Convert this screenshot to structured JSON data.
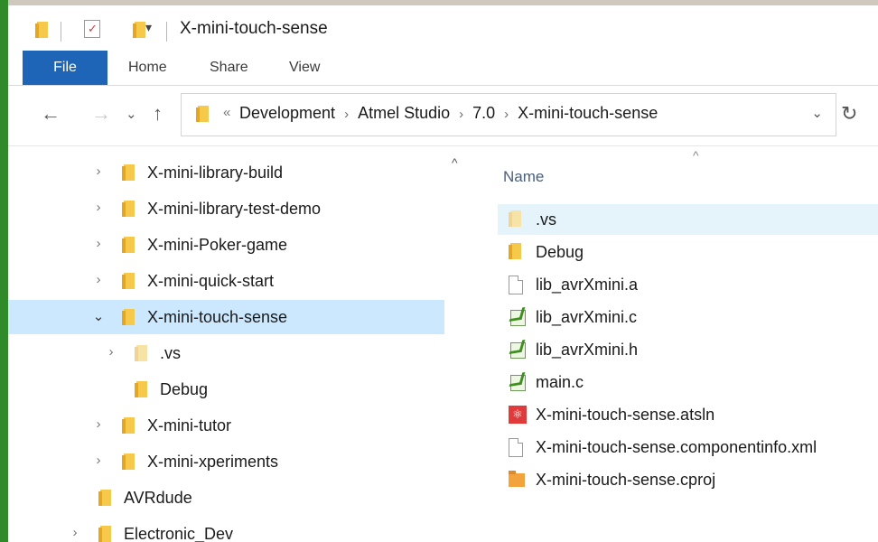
{
  "window": {
    "title": "X-mini-touch-sense"
  },
  "quick_access": {
    "customize_glyph": "▾"
  },
  "ribbon": {
    "tabs": [
      {
        "label": "File",
        "active": true
      },
      {
        "label": "Home"
      },
      {
        "label": "Share"
      },
      {
        "label": "View"
      }
    ]
  },
  "nav": {
    "back_glyph": "←",
    "forward_glyph": "→",
    "recent_glyph": "⌄",
    "up_glyph": "↑",
    "refresh_glyph": "↻"
  },
  "address": {
    "overflow_glyph": "«",
    "crumbs": [
      "Development",
      "Atmel Studio",
      "7.0",
      "X-mini-touch-sense"
    ],
    "separator": "›",
    "dropdown_glyph": "⌄"
  },
  "tree": {
    "items": [
      {
        "label": "X-mini-library-build",
        "expander": "›"
      },
      {
        "label": "X-mini-library-test-demo",
        "expander": "›"
      },
      {
        "label": "X-mini-Poker-game",
        "expander": "›"
      },
      {
        "label": "X-mini-quick-start",
        "expander": "›"
      },
      {
        "label": "X-mini-touch-sense",
        "expander": "⌄",
        "selected": true
      },
      {
        "label": ".vs",
        "expander": "›"
      },
      {
        "label": "Debug",
        "expander": ""
      },
      {
        "label": "X-mini-tutor",
        "expander": "›"
      },
      {
        "label": "X-mini-xperiments",
        "expander": "›"
      },
      {
        "label": "AVRdude",
        "expander": ""
      },
      {
        "label": "Electronic_Dev",
        "expander": "›"
      }
    ]
  },
  "scroll": {
    "up_glyph": "^"
  },
  "file_list": {
    "sort_glyph": "^",
    "column_name": "Name",
    "items": [
      {
        "name": ".vs",
        "icon": "folder-faded-icon"
      },
      {
        "name": "Debug",
        "icon": "folder-icon"
      },
      {
        "name": "lib_avrXmini.a",
        "icon": "document-icon"
      },
      {
        "name": "lib_avrXmini.c",
        "icon": "c-source-icon"
      },
      {
        "name": "lib_avrXmini.h",
        "icon": "c-header-icon"
      },
      {
        "name": "main.c",
        "icon": "c-source-icon"
      },
      {
        "name": "X-mini-touch-sense.atsln",
        "icon": "atmel-solution-icon"
      },
      {
        "name": "X-mini-touch-sense.componentinfo.xml",
        "icon": "document-icon"
      },
      {
        "name": "X-mini-touch-sense.cproj",
        "icon": "project-icon"
      }
    ]
  },
  "colors": {
    "file_tab": "#1e65b8",
    "selection": "#cce8ff",
    "hover": "#e5f3fb",
    "folder": "#f6c94a"
  }
}
